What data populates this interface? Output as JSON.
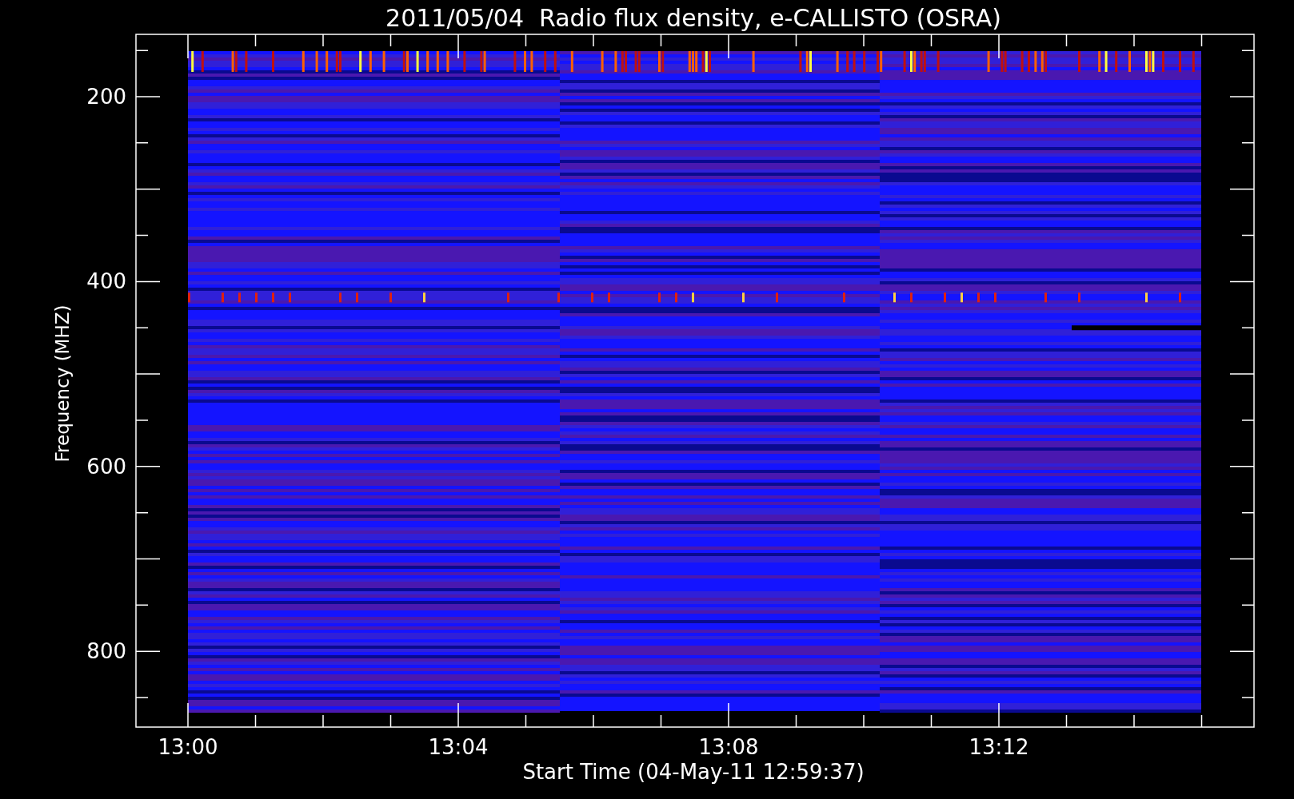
{
  "title": "2011/05/04  Radio flux density, e-CALLISTO (OSRA)",
  "y_axis": {
    "label": "Frequency (MHZ)",
    "ticks": [
      "200",
      "400",
      "600",
      "800"
    ]
  },
  "x_axis": {
    "label": "Start Time (04-May-11 12:59:37)",
    "ticks": [
      "13:00",
      "13:04",
      "13:08",
      "13:12"
    ]
  }
}
